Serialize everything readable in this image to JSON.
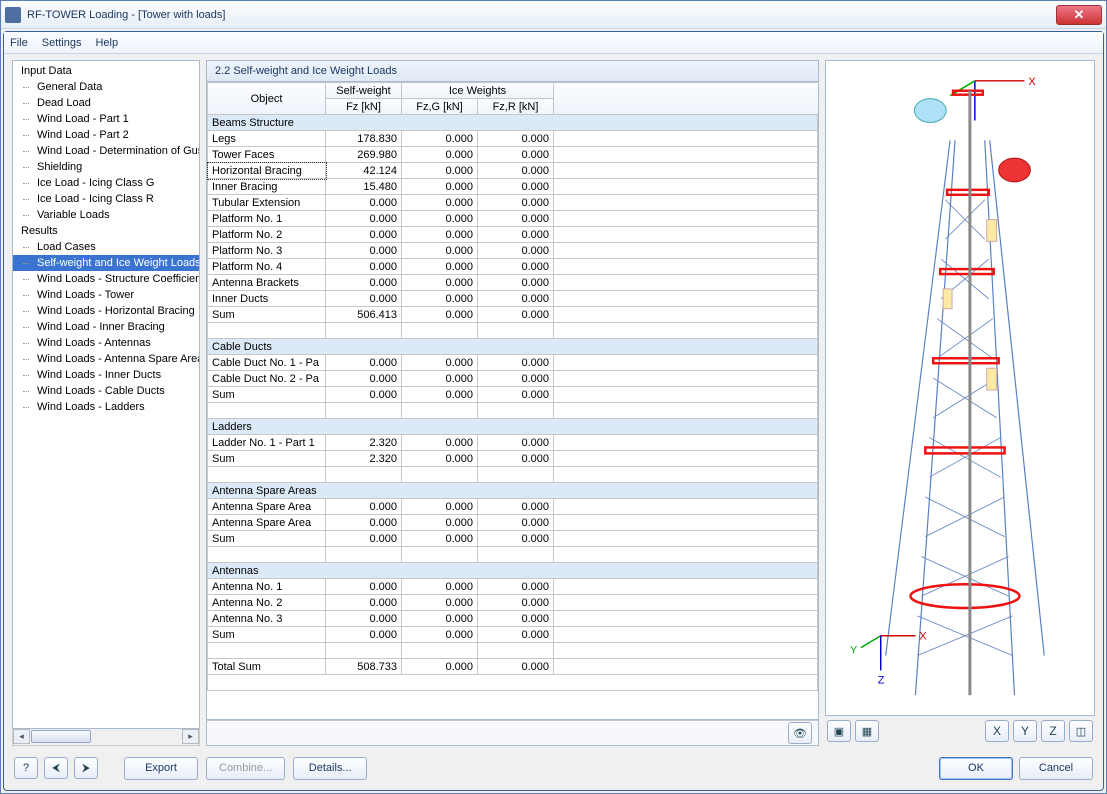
{
  "window": {
    "title": "RF-TOWER Loading - [Tower with loads]"
  },
  "menu": {
    "file": "File",
    "settings": "Settings",
    "help": "Help"
  },
  "tree": {
    "input_header": "Input Data",
    "input_items": [
      "General Data",
      "Dead Load",
      "Wind Load - Part 1",
      "Wind Load - Part 2",
      "Wind Load - Determination of Gust",
      "Shielding",
      "Ice Load - Icing Class G",
      "Ice Load - Icing Class R",
      "Variable Loads"
    ],
    "results_header": "Results",
    "results_items": [
      "Load Cases",
      "Self-weight and Ice Weight Loads",
      "Wind Loads - Structure Coefficients",
      "Wind Loads - Tower",
      "Wind Loads - Horizontal Bracing",
      "Wind Load - Inner Bracing",
      "Wind Loads - Antennas",
      "Wind Loads - Antenna Spare Areas",
      "Wind Loads - Inner Ducts",
      "Wind Loads - Cable Ducts",
      "Wind Loads - Ladders"
    ],
    "selected": "Self-weight and Ice Weight Loads"
  },
  "section": {
    "title": "2.2 Self-weight and Ice Weight Loads"
  },
  "table": {
    "head": {
      "object": "Object",
      "self_group": "Self-weight",
      "ice_group": "Ice Weights",
      "fz": "Fz [kN]",
      "fzg": "Fz,G [kN]",
      "fzr": "Fz,R [kN]"
    },
    "groups": [
      {
        "name": "Beams Structure",
        "rows": [
          {
            "o": "Legs",
            "a": "178.830",
            "b": "0.000",
            "c": "0.000"
          },
          {
            "o": "Tower Faces",
            "a": "269.980",
            "b": "0.000",
            "c": "0.000"
          },
          {
            "o": "Horizontal Bracing",
            "a": "42.124",
            "b": "0.000",
            "c": "0.000",
            "sel": true
          },
          {
            "o": "Inner Bracing",
            "a": "15.480",
            "b": "0.000",
            "c": "0.000"
          },
          {
            "o": "Tubular Extension",
            "a": "0.000",
            "b": "0.000",
            "c": "0.000"
          },
          {
            "o": "Platform No. 1",
            "a": "0.000",
            "b": "0.000",
            "c": "0.000"
          },
          {
            "o": "Platform No. 2",
            "a": "0.000",
            "b": "0.000",
            "c": "0.000"
          },
          {
            "o": "Platform No. 3",
            "a": "0.000",
            "b": "0.000",
            "c": "0.000"
          },
          {
            "o": "Platform No. 4",
            "a": "0.000",
            "b": "0.000",
            "c": "0.000"
          },
          {
            "o": "Antenna Brackets",
            "a": "0.000",
            "b": "0.000",
            "c": "0.000"
          },
          {
            "o": "Inner Ducts",
            "a": "0.000",
            "b": "0.000",
            "c": "0.000"
          },
          {
            "o": "Sum",
            "a": "506.413",
            "b": "0.000",
            "c": "0.000"
          }
        ]
      },
      {
        "name": "Cable Ducts",
        "rows": [
          {
            "o": "Cable Duct No. 1 - Pa",
            "a": "0.000",
            "b": "0.000",
            "c": "0.000"
          },
          {
            "o": "Cable Duct No. 2 - Pa",
            "a": "0.000",
            "b": "0.000",
            "c": "0.000"
          },
          {
            "o": "Sum",
            "a": "0.000",
            "b": "0.000",
            "c": "0.000"
          }
        ]
      },
      {
        "name": "Ladders",
        "rows": [
          {
            "o": "Ladder No. 1 - Part 1",
            "a": "2.320",
            "b": "0.000",
            "c": "0.000"
          },
          {
            "o": "Sum",
            "a": "2.320",
            "b": "0.000",
            "c": "0.000"
          }
        ]
      },
      {
        "name": "Antenna Spare Areas",
        "rows": [
          {
            "o": "Antenna Spare Area",
            "a": "0.000",
            "b": "0.000",
            "c": "0.000"
          },
          {
            "o": "Antenna Spare Area",
            "a": "0.000",
            "b": "0.000",
            "c": "0.000"
          },
          {
            "o": "Sum",
            "a": "0.000",
            "b": "0.000",
            "c": "0.000"
          }
        ]
      },
      {
        "name": "Antennas",
        "rows": [
          {
            "o": "Antenna No. 1",
            "a": "0.000",
            "b": "0.000",
            "c": "0.000"
          },
          {
            "o": "Antenna No. 2",
            "a": "0.000",
            "b": "0.000",
            "c": "0.000"
          },
          {
            "o": "Antenna No. 3",
            "a": "0.000",
            "b": "0.000",
            "c": "0.000"
          },
          {
            "o": "Sum",
            "a": "0.000",
            "b": "0.000",
            "c": "0.000"
          }
        ]
      }
    ],
    "total": {
      "o": "Total Sum",
      "a": "508.733",
      "b": "0.000",
      "c": "0.000"
    }
  },
  "footer": {
    "export": "Export",
    "combine": "Combine...",
    "details": "Details...",
    "ok": "OK",
    "cancel": "Cancel"
  },
  "axes": {
    "x": "X",
    "y": "Y",
    "z": "Z"
  },
  "viewbtn": {
    "vx": "X",
    "vy": "Y",
    "vz": "Z"
  }
}
